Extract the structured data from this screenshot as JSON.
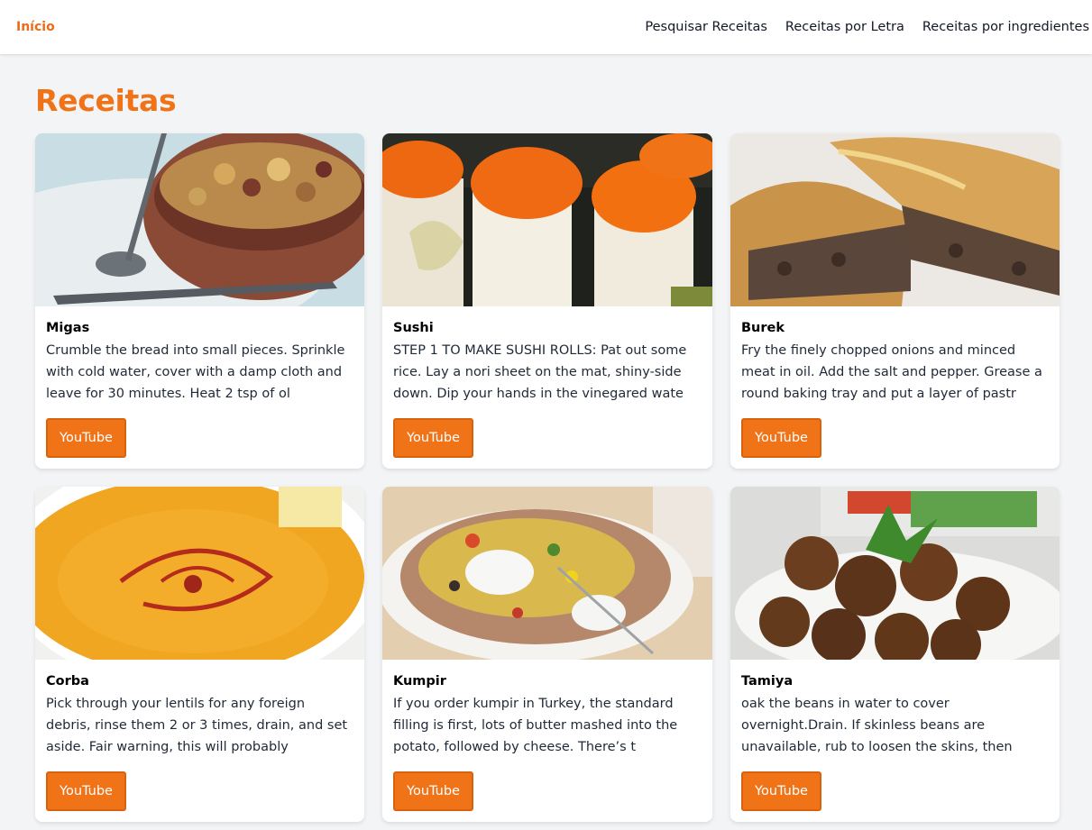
{
  "nav": {
    "brand": "Início",
    "links": [
      "Pesquisar Receitas",
      "Receitas por Letra",
      "Receitas por ingredientes"
    ]
  },
  "page": {
    "title": "Receitas"
  },
  "colors": {
    "accent": "#f07318",
    "background": "#f3f4f6"
  },
  "recipes": [
    {
      "name": "Migas",
      "description": "Crumble the bread into small pieces. Sprinkle with cold water, cover with a damp cloth and leave for 30 minutes. Heat 2 tsp of ol",
      "button": "YouTube",
      "image": "migas-photo"
    },
    {
      "name": "Sushi",
      "description": "STEP 1 TO MAKE SUSHI ROLLS: Pat out some rice. Lay a nori sheet on the mat, shiny-side down. Dip your hands in the vinegared wate",
      "button": "YouTube",
      "image": "sushi-photo"
    },
    {
      "name": "Burek",
      "description": "Fry the finely chopped onions and minced meat in oil. Add the salt and pepper. Grease a round baking tray and put a layer of pastr",
      "button": "YouTube",
      "image": "burek-photo"
    },
    {
      "name": "Corba",
      "description": "Pick through your lentils for any foreign debris, rinse them 2 or 3 times, drain, and set aside. Fair warning, this will probably",
      "button": "YouTube",
      "image": "corba-photo"
    },
    {
      "name": "Kumpir",
      "description": "If you order kumpir in Turkey, the standard filling is first, lots of butter mashed into the potato, followed by cheese. There’s t",
      "button": "YouTube",
      "image": "kumpir-photo"
    },
    {
      "name": "Tamiya",
      "description": "oak the beans in water to cover overnight.Drain. If skinless beans are unavailable, rub to loosen the skins, then discard the skin",
      "button": "YouTube",
      "image": "tamiya-photo"
    }
  ]
}
